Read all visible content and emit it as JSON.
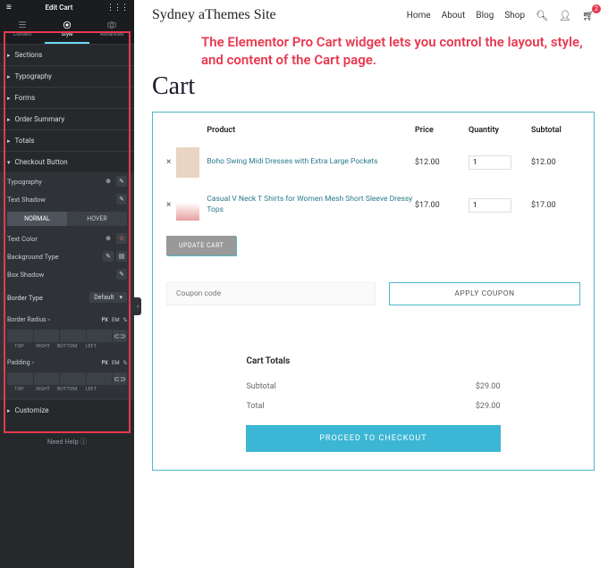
{
  "editor": {
    "title": "Edit Cart",
    "tabs": {
      "content": "Content",
      "style": "Style",
      "advanced": "Advanced"
    },
    "sections": [
      "Sections",
      "Typography",
      "Forms",
      "Order Summary",
      "Totals",
      "Checkout Button",
      "Customize"
    ],
    "checkout": {
      "typography": "Typography",
      "text_shadow": "Text Shadow",
      "normal": "NORMAL",
      "hover": "HOVER",
      "text_color": "Text Color",
      "bg_type": "Background Type",
      "box_shadow": "Box Shadow",
      "border_type": "Border Type",
      "border_type_val": "Default",
      "border_radius": "Border Radius",
      "padding": "Padding",
      "units": {
        "px": "PX",
        "em": "EM",
        "pct": "%"
      },
      "sides": {
        "top": "TOP",
        "right": "RIGHT",
        "bottom": "BOTTOM",
        "left": "LEFT"
      }
    },
    "help": "Need Help"
  },
  "site": {
    "title": "Sydney aThemes Site",
    "nav": [
      "Home",
      "About",
      "Blog",
      "Shop"
    ],
    "cart_badge": "2"
  },
  "annotation": "The Elementor Pro Cart widget lets you control the layout, style, and content of the Cart page.",
  "page_title": "Cart",
  "cart": {
    "head": {
      "product": "Product",
      "price": "Price",
      "qty": "Quantity",
      "subtotal": "Subtotal"
    },
    "items": [
      {
        "name": "Boho Swing Midi Dresses with Extra Large Pockets",
        "price": "$12.00",
        "qty": "1",
        "subtotal": "$12.00"
      },
      {
        "name": "Casual V Neck T Shirts for Women Mesh Short Sleeve Dressy Tops",
        "price": "$17.00",
        "qty": "1",
        "subtotal": "$17.00"
      }
    ],
    "update": "UPDATE CART",
    "coupon_ph": "Coupon code",
    "apply": "APPLY COUPON"
  },
  "totals": {
    "title": "Cart Totals",
    "subtotal_l": "Subtotal",
    "subtotal_v": "$29.00",
    "total_l": "Total",
    "total_v": "$29.00",
    "checkout": "PROCEED TO CHECKOUT"
  }
}
